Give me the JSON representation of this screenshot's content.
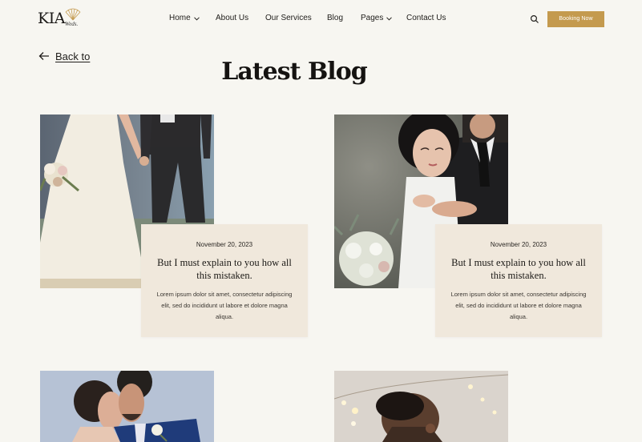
{
  "header": {
    "logo_main": "KIA",
    "logo_sub": "Weds.",
    "nav": [
      {
        "label": "Home",
        "dropdown": true
      },
      {
        "label": "About Us",
        "dropdown": false
      },
      {
        "label": "Our Services",
        "dropdown": false
      },
      {
        "label": "Blog",
        "dropdown": false
      },
      {
        "label": "Pages",
        "dropdown": true
      },
      {
        "label": "Contact Us",
        "dropdown": false
      }
    ],
    "search_icon": "search-icon",
    "booking_label": "Booking Now",
    "accent_color": "#c49a4e"
  },
  "back": {
    "label": "Back to",
    "icon": "arrow-left-icon"
  },
  "page_title": "Latest Blog",
  "posts": [
    {
      "date": "November 20, 2023",
      "title": "But I must explain to you how all this mistaken.",
      "excerpt": "Lorem ipsum dolor sit amet, consectetur adipiscing elit, sed do incididunt ut labore et dolore magna aliqua.",
      "image": "bride-and-groom-walking-photo"
    },
    {
      "date": "November 20, 2023",
      "title": "But I must explain to you how all this mistaken.",
      "excerpt": "Lorem ipsum dolor sit amet, consectetur adipiscing elit, sed do incididunt ut labore et dolore magna aliqua.",
      "image": "couple-embracing-bouquet-photo"
    },
    {
      "image": "couple-forehead-touch-photo"
    },
    {
      "image": "groom-string-lights-photo"
    }
  ],
  "colors": {
    "background": "#f7f6f1",
    "card_box": "#f0e8dc",
    "accent": "#c49a4e"
  }
}
